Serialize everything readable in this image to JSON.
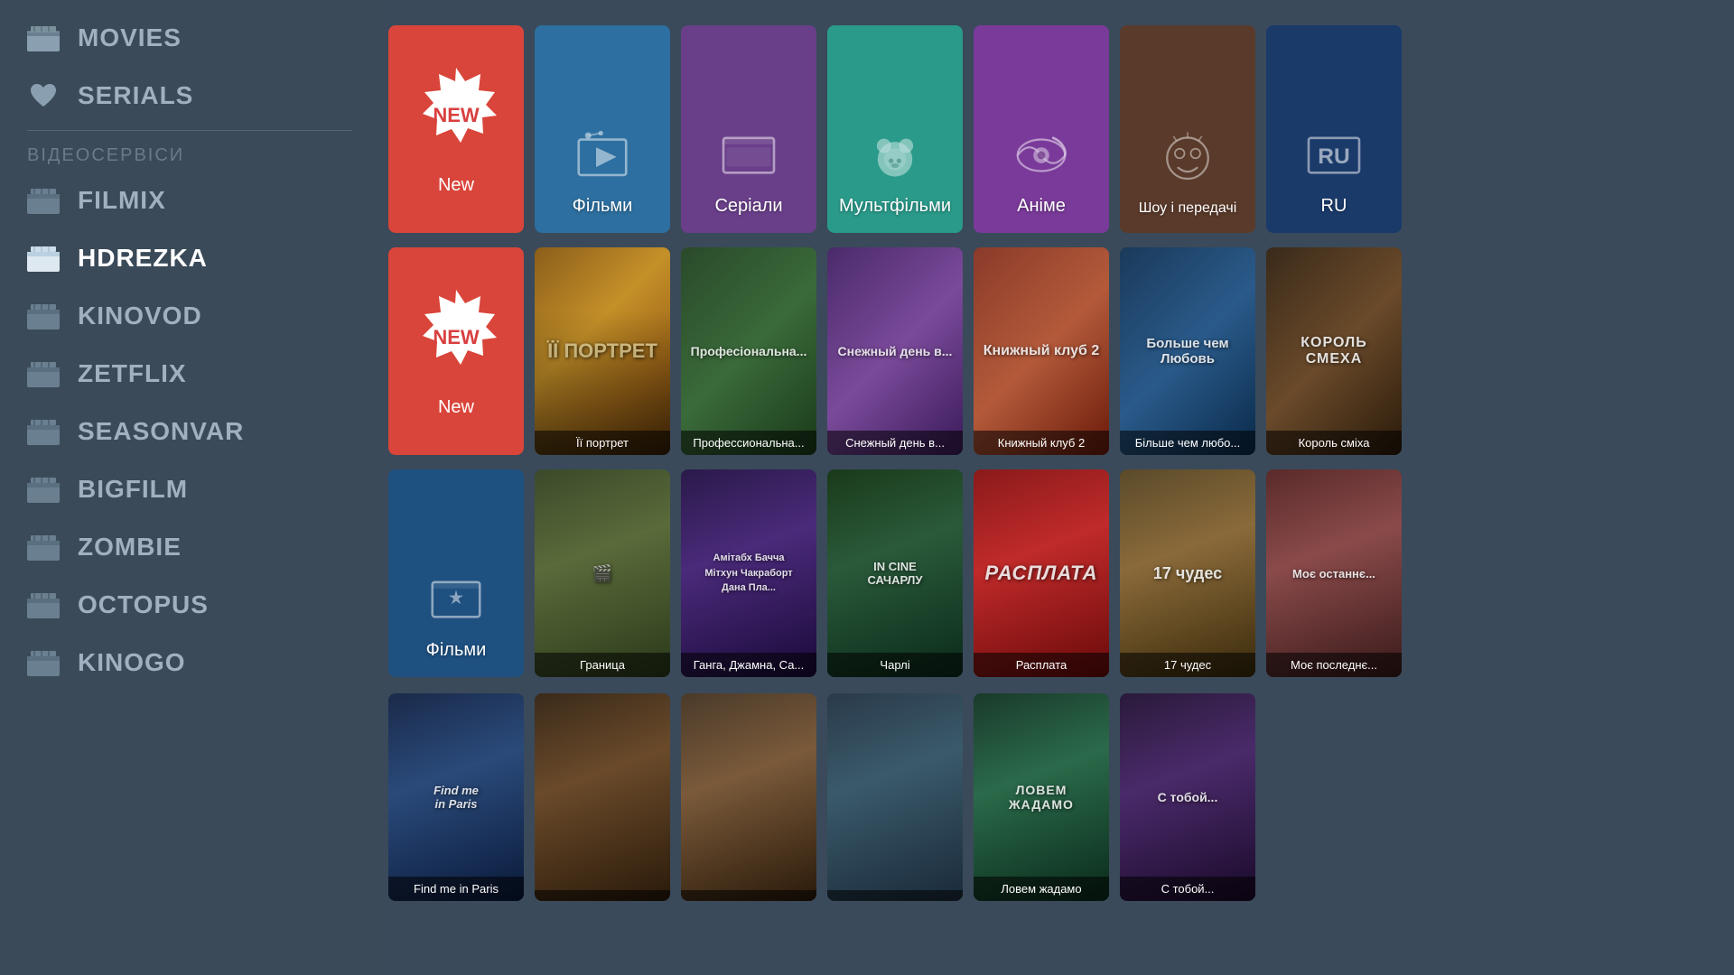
{
  "sidebar": {
    "section_label": "ВІДЕОСЕРВІСИ",
    "items": [
      {
        "id": "movies",
        "label": "MOVIES",
        "active": false
      },
      {
        "id": "serials",
        "label": "SERIALS",
        "active": false,
        "icon": "heart"
      },
      {
        "id": "filmix",
        "label": "FILMIX",
        "active": false
      },
      {
        "id": "hdrezka",
        "label": "HDREZKA",
        "active": true
      },
      {
        "id": "kinovod",
        "label": "KINOVOD",
        "active": false
      },
      {
        "id": "zetflix",
        "label": "ZETFLIX",
        "active": false
      },
      {
        "id": "seasonvar",
        "label": "SEASONVAR",
        "active": false
      },
      {
        "id": "bigfilm",
        "label": "BIGFILM",
        "active": false
      },
      {
        "id": "zombie",
        "label": "ZOMBIE",
        "active": false
      },
      {
        "id": "octopus",
        "label": "OCTOPUS",
        "active": false
      },
      {
        "id": "kinogo",
        "label": "KINOGO",
        "active": false
      }
    ]
  },
  "categories": [
    {
      "id": "new1",
      "type": "new",
      "label": "New"
    },
    {
      "id": "filmy",
      "type": "cat",
      "label": "Фільми",
      "color": "tile-blue"
    },
    {
      "id": "serials",
      "type": "cat",
      "label": "Серіали",
      "color": "tile-purple"
    },
    {
      "id": "multfilmy",
      "type": "cat",
      "label": "Мультфільми",
      "color": "tile-teal"
    },
    {
      "id": "anime",
      "type": "cat",
      "label": "Аніме",
      "color": "tile-violet"
    },
    {
      "id": "show",
      "type": "cat",
      "label": "Шоу і передачі",
      "color": "tile-brown"
    },
    {
      "id": "ru",
      "type": "cat",
      "label": "RU",
      "color": "tile-dark-blue"
    }
  ],
  "row2": {
    "new_label": "New",
    "movies": [
      {
        "id": "eeportret",
        "title": "Її портрет",
        "bg": "movie-bg-1",
        "text": "ЇЇ ПОРТРЕТ"
      },
      {
        "id": "professionalnaya",
        "title": "Профессиональна...",
        "bg": "movie-bg-2",
        "text": "Професіональна..."
      },
      {
        "id": "snezhnyi",
        "title": "Снежный день в...",
        "bg": "movie-bg-3",
        "text": ""
      },
      {
        "id": "knizhnyi",
        "title": "Книжный клуб 2",
        "bg": "movie-bg-4",
        "text": "Книжный клуб 2"
      },
      {
        "id": "bolshe",
        "title": "Більше чем любо...",
        "bg": "movie-bg-5",
        "text": "Больше чем Любовь"
      },
      {
        "id": "korol",
        "title": "Король сміха",
        "bg": "movie-bg-6",
        "text": "КОРОЛЬ СМЕХА"
      }
    ]
  },
  "row3": {
    "filmy_label": "Фільми",
    "movies": [
      {
        "id": "granitsa",
        "title": "Граница",
        "bg": "movie-bg-7",
        "text": ""
      },
      {
        "id": "ganga",
        "title": "Ганга, Джамна, Са...",
        "bg": "movie-bg-8",
        "text": "Амітабх Бачча\nМітхун Чакраборт\nДана Пла..."
      },
      {
        "id": "charli",
        "title": "Чарлі",
        "bg": "movie-bg-1",
        "text": "IN CINE\nСАЧАРЛУ"
      },
      {
        "id": "rasplata",
        "title": "Расплата",
        "bg": "movie-bg-4",
        "text": "РАСПЛАТА"
      },
      {
        "id": "17chudes",
        "title": "17 чудес",
        "bg": "movie-bg-2",
        "text": "17 чудес"
      },
      {
        "id": "moeposlede",
        "title": "Моє последнє...",
        "bg": "movie-bg-5",
        "text": ""
      }
    ]
  },
  "row4": {
    "movies": [
      {
        "id": "findme",
        "title": "Find me in Paris",
        "bg": "movie-bg-3",
        "text": "Find me in Paris"
      },
      {
        "id": "m2",
        "title": "",
        "bg": "movie-bg-6",
        "text": ""
      },
      {
        "id": "m3",
        "title": "",
        "bg": "movie-bg-7",
        "text": ""
      },
      {
        "id": "m4",
        "title": "",
        "bg": "movie-bg-8",
        "text": ""
      },
      {
        "id": "lovem",
        "title": "Ловем жадамо",
        "bg": "movie-bg-1",
        "text": "ЛОВЕМ ЖАДАМО"
      },
      {
        "id": "stoboy",
        "title": "С тобой...",
        "bg": "movie-bg-2",
        "text": "С тобой..."
      }
    ]
  }
}
